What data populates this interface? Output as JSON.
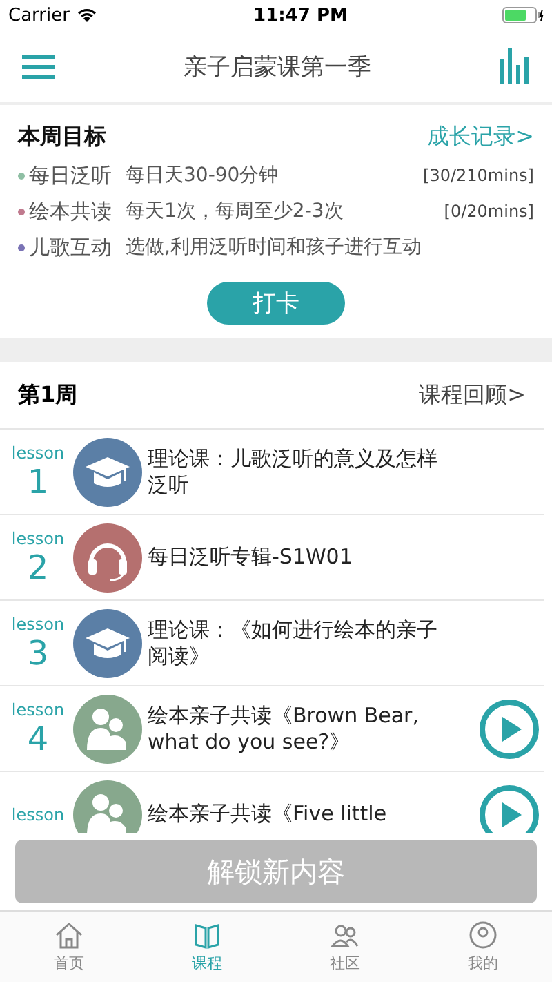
{
  "status_bar": {
    "carrier": "Carrier",
    "time": "11:47 PM"
  },
  "nav": {
    "title": "亲子启蒙课第一季"
  },
  "goals": {
    "title": "本周目标",
    "link": "成长记录>",
    "button": "打卡",
    "items": [
      {
        "name": "每日泛听",
        "desc": "每日天30-90分钟",
        "progress": "[30/210mins]",
        "color": "#8fbfa4"
      },
      {
        "name": "绘本共读",
        "desc": "每天1次，每周至少2-3次",
        "progress": "[0/20mins]",
        "color": "#c07a8e"
      },
      {
        "name": "儿歌互动",
        "desc": "选做,利用泛听时间和孩子进行互动",
        "color": "#7a73b5"
      }
    ]
  },
  "week": {
    "title": "第1周",
    "link": "课程回顾>"
  },
  "lessons": [
    {
      "label": "lesson",
      "number": "1",
      "kind": "lecture",
      "title": "理论课：儿歌泛听的意义及怎样泛听",
      "playable": false
    },
    {
      "label": "lesson",
      "number": "2",
      "kind": "audio",
      "title": "每日泛听专辑-S1W01",
      "playable": false
    },
    {
      "label": "lesson",
      "number": "3",
      "kind": "lecture",
      "title": "理论课：《如何进行绘本的亲子阅读》",
      "playable": false
    },
    {
      "label": "lesson",
      "number": "4",
      "kind": "reading",
      "title": "绘本亲子共读《Brown Bear, what do you see?》",
      "playable": true
    },
    {
      "label": "lesson",
      "kind": "reading",
      "title": "绘本亲子共读《Five little",
      "playable": true
    }
  ],
  "unlock_button": "解锁新内容",
  "tabs": [
    {
      "label": "首页",
      "kind": "home",
      "selected": false
    },
    {
      "label": "课程",
      "kind": "course",
      "selected": true
    },
    {
      "label": "社区",
      "kind": "community",
      "selected": false
    },
    {
      "label": "我的",
      "kind": "me",
      "selected": false
    }
  ]
}
